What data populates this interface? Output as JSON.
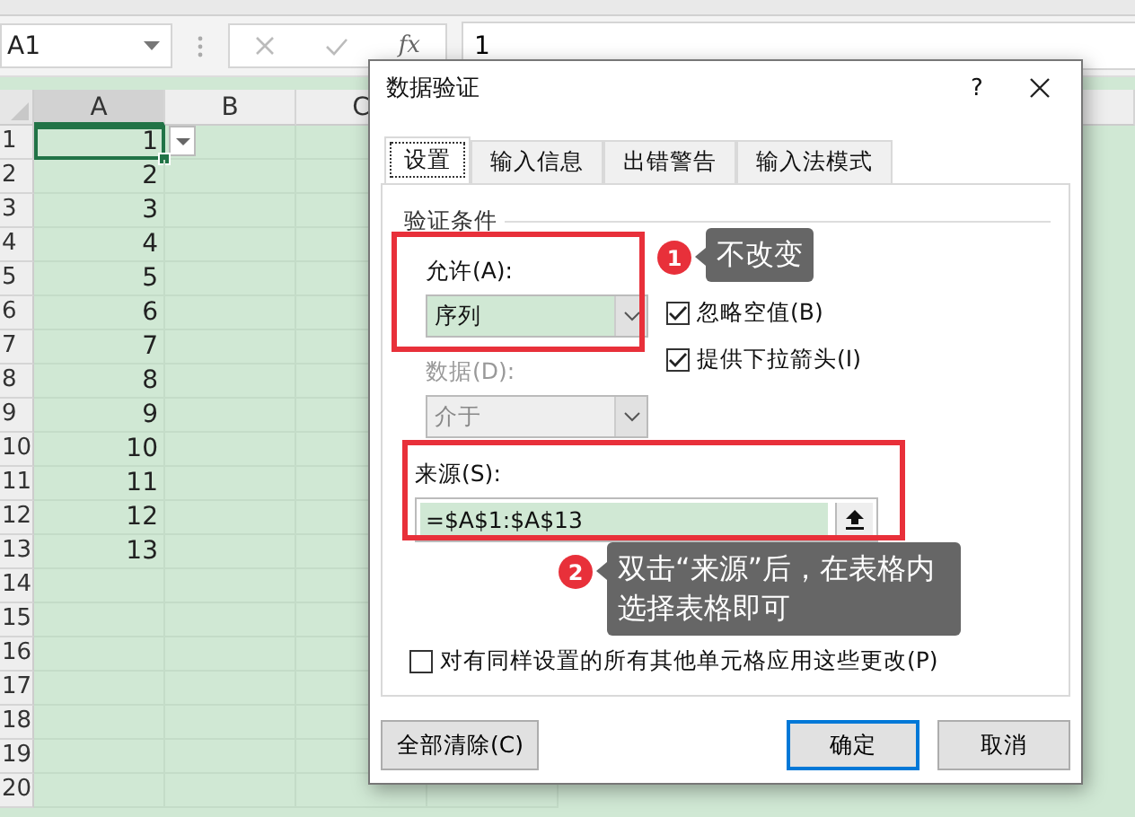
{
  "formula_bar": {
    "name_box": "A1",
    "function_label": "fx",
    "value": "1"
  },
  "sheet": {
    "columns": [
      {
        "label": "A",
        "selected": true
      },
      {
        "label": "B",
        "selected": false
      },
      {
        "label": "C",
        "selected": false
      }
    ],
    "rows": [
      {
        "header": "1",
        "value": "1",
        "active": true
      },
      {
        "header": "2",
        "value": "2",
        "active": false
      },
      {
        "header": "3",
        "value": "3",
        "active": false
      },
      {
        "header": "4",
        "value": "4",
        "active": false
      },
      {
        "header": "5",
        "value": "5",
        "active": false
      },
      {
        "header": "6",
        "value": "6",
        "active": false
      },
      {
        "header": "7",
        "value": "7",
        "active": false
      },
      {
        "header": "8",
        "value": "8",
        "active": false
      },
      {
        "header": "9",
        "value": "9",
        "active": false
      },
      {
        "header": "10",
        "value": "10",
        "active": false
      },
      {
        "header": "11",
        "value": "11",
        "active": false
      },
      {
        "header": "12",
        "value": "12",
        "active": false
      },
      {
        "header": "13",
        "value": "13",
        "active": false
      },
      {
        "header": "14",
        "active": false
      },
      {
        "header": "15",
        "active": false
      },
      {
        "header": "16",
        "active": false
      },
      {
        "header": "17",
        "active": false
      },
      {
        "header": "18",
        "active": false
      },
      {
        "header": "19",
        "active": false
      },
      {
        "header": "20",
        "active": false
      }
    ]
  },
  "dialog": {
    "title": "数据验证",
    "help": "?",
    "tabs": [
      {
        "label": "设置",
        "selected": true
      },
      {
        "label": "输入信息",
        "selected": false
      },
      {
        "label": "出错警告",
        "selected": false
      },
      {
        "label": "输入法模式",
        "selected": false
      }
    ],
    "group_title": "验证条件",
    "allow": {
      "label": "允许(A):",
      "value": "序列",
      "disabled": false
    },
    "data": {
      "label": "数据(D):",
      "value": "介于",
      "disabled": true
    },
    "checkboxes": [
      {
        "label": "忽略空值(B)",
        "checked": true
      },
      {
        "label": "提供下拉箭头(I)",
        "checked": true
      }
    ],
    "source": {
      "label": "来源(S):",
      "value": "=$A$1:$A$13"
    },
    "apply_all": {
      "label": "对有同样设置的所有其他单元格应用这些更改(P)",
      "checked": false
    },
    "buttons": [
      {
        "label": "全部清除(C)",
        "default": false
      },
      {
        "label": "确定",
        "default": true
      },
      {
        "label": "取消",
        "default": false
      }
    ]
  },
  "annotations": [
    {
      "number": "1",
      "text": "不改变"
    },
    {
      "number": "2",
      "text": "双击“来源”后，在表格内选择表格即可"
    }
  ]
}
